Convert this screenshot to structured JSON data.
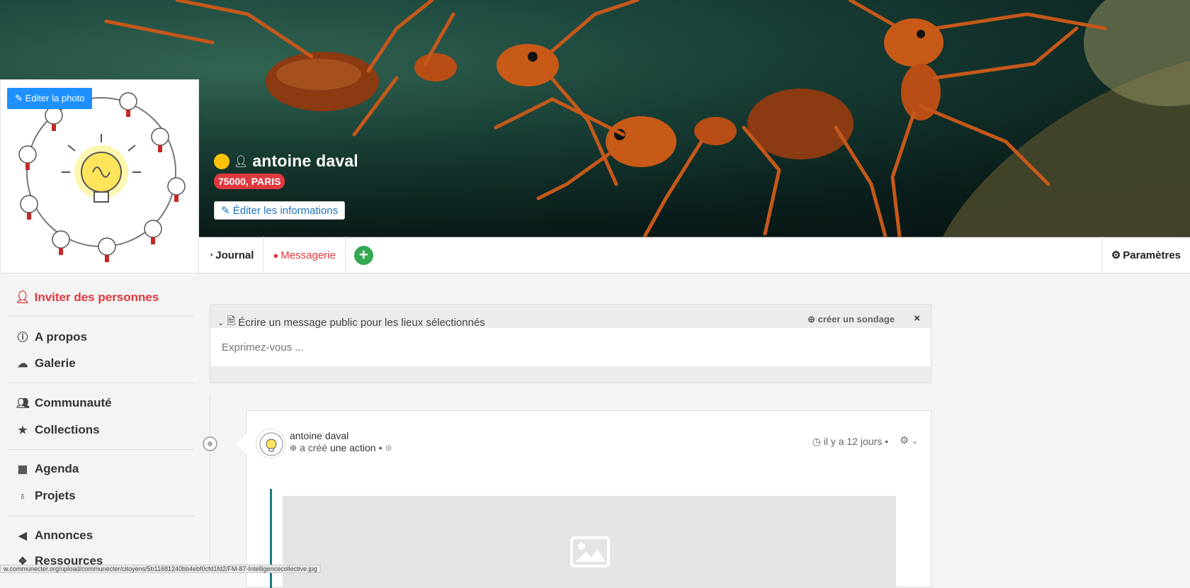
{
  "banner": {
    "alt": "ants-cover"
  },
  "profile": {
    "edit_photo_label": "Editer la photo",
    "name": "antoine daval",
    "location": "75000, PARIS",
    "edit_info_label": "Éditer les informations",
    "status_color": "#ffc107"
  },
  "tabs": {
    "journal": "Journal",
    "messages": "Messagerie",
    "params": "Paramètres"
  },
  "sidebar": {
    "invite": "Inviter des personnes",
    "items": [
      {
        "label": "A propos",
        "icon": "info-icon"
      },
      {
        "label": "Galerie",
        "icon": "cloud-icon"
      },
      {
        "label": "Communauté",
        "icon": "users-icon"
      },
      {
        "label": "Collections",
        "icon": "star-icon"
      },
      {
        "label": "Agenda",
        "icon": "calendar-icon"
      },
      {
        "label": "Projets",
        "icon": "lightbulb-icon"
      },
      {
        "label": "Annonces",
        "icon": "bullhorn-icon"
      },
      {
        "label": "Ressources",
        "icon": "cubes-icon"
      }
    ]
  },
  "composer": {
    "heading": "Écrire un message public pour les lieux sélectionnés",
    "poll": "créer un sondage",
    "close": "×",
    "placeholder": "Exprimez-vous ..."
  },
  "post": {
    "author": "antoine daval",
    "action_prefix": "a créé",
    "action_link": "une action",
    "bullet": "•",
    "time": "il y a 12 jours",
    "time_bullet": "•"
  },
  "status_bar": {
    "url": "w.communecter.org/upload/communecter/citoyens/5b11681240bb4ebf0cfd1fd2/FM-87-Intelligencecollective.jpg"
  },
  "colors": {
    "accent_red": "#e0383e",
    "accent_blue": "#1e90ff",
    "accent_green": "#34a853"
  }
}
